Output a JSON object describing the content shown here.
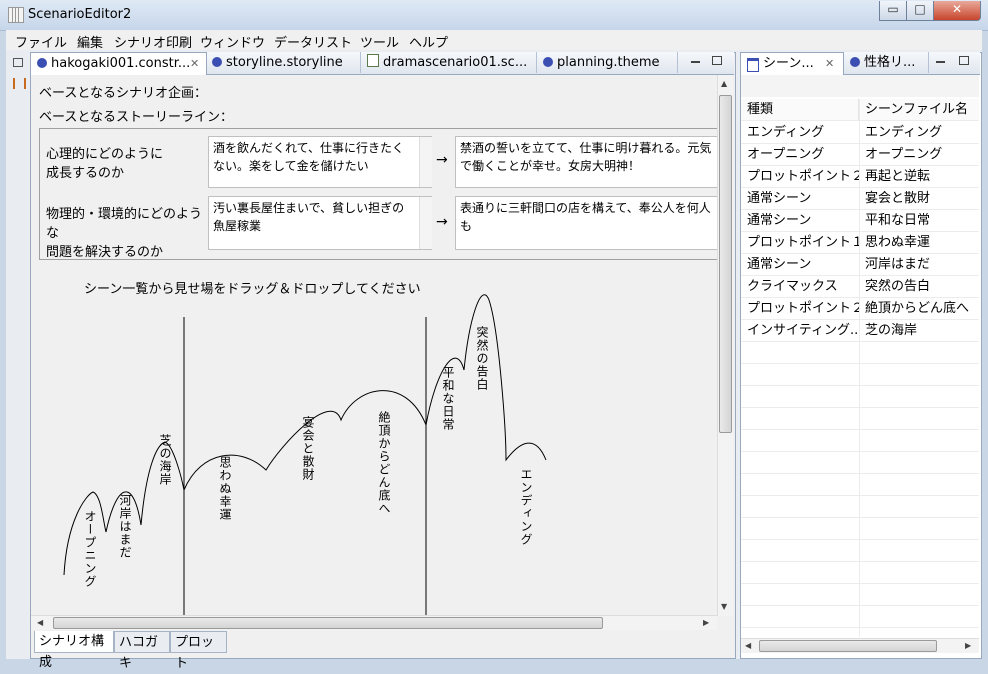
{
  "window": {
    "title": "ScenarioEditor2",
    "controls": {
      "minimize": "▭",
      "maximize": "□",
      "close": "✕"
    }
  },
  "menu": [
    "ファイル",
    "編集",
    "シナリオ印刷",
    "ウィンドウ",
    "データリスト",
    "ツール",
    "ヘルプ"
  ],
  "editor": {
    "tabs": [
      {
        "label": "hakogaki001.constr...",
        "icon": "theme-icon"
      },
      {
        "label": "storyline.storyline",
        "icon": "theme-icon"
      },
      {
        "label": "dramascenario01.sc...",
        "icon": "document-icon"
      },
      {
        "label": "planning.theme",
        "icon": "theme-icon"
      }
    ],
    "base_plan_label": "ベースとなるシナリオ企画：",
    "base_storyline_label": "ベースとなるストーリーライン：",
    "rows": [
      {
        "question": "心理的にどのように\n成長するのか",
        "before": "酒を飲んだくれて、仕事に行きたくない。楽をして金を儲けたい",
        "arrow": "→",
        "after": "禁酒の誓いを立てて、仕事に明け暮れる。元気で働くことが幸せ。女房大明神！"
      },
      {
        "question": "物理的・環境的にどのような\n問題を解決するのか",
        "before": "汚い裏長屋住まいで、貧しい担ぎの魚屋稼業",
        "arrow": "→",
        "after": "表通りに三軒間口の店を構えて、奉公人を何人も"
      }
    ],
    "drop_hint": "シーン一覧から見せ場をドラッグ＆ドロップしてください",
    "scenes": [
      "オープニング",
      "河岸はまだ",
      "芝の海岸",
      "思わぬ幸運",
      "宴会と散財",
      "絶頂からどん底へ",
      "平和な日常",
      "突然の告白",
      "エンディング"
    ],
    "bottom_tabs": [
      "シナリオ構成",
      "ハコガキ",
      "プロット"
    ]
  },
  "scene_view": {
    "tabs": [
      {
        "label": "シーン..."
      },
      {
        "label": "性格リ..."
      }
    ],
    "columns": [
      "種類",
      "シーンファイル名"
    ],
    "rows": [
      [
        "エンディング",
        "エンディング"
      ],
      [
        "オープニング",
        "オープニング"
      ],
      [
        "プロットポイント２",
        "再起と逆転"
      ],
      [
        "通常シーン",
        "宴会と散財"
      ],
      [
        "通常シーン",
        "平和な日常"
      ],
      [
        "プロットポイント１",
        "思わぬ幸運"
      ],
      [
        "通常シーン",
        "河岸はまだ"
      ],
      [
        "クライマックス",
        "突然の告白"
      ],
      [
        "プロットポイント２",
        "絶頂からどん底へ"
      ],
      [
        "インサイティング...",
        "芝の海岸"
      ]
    ]
  }
}
